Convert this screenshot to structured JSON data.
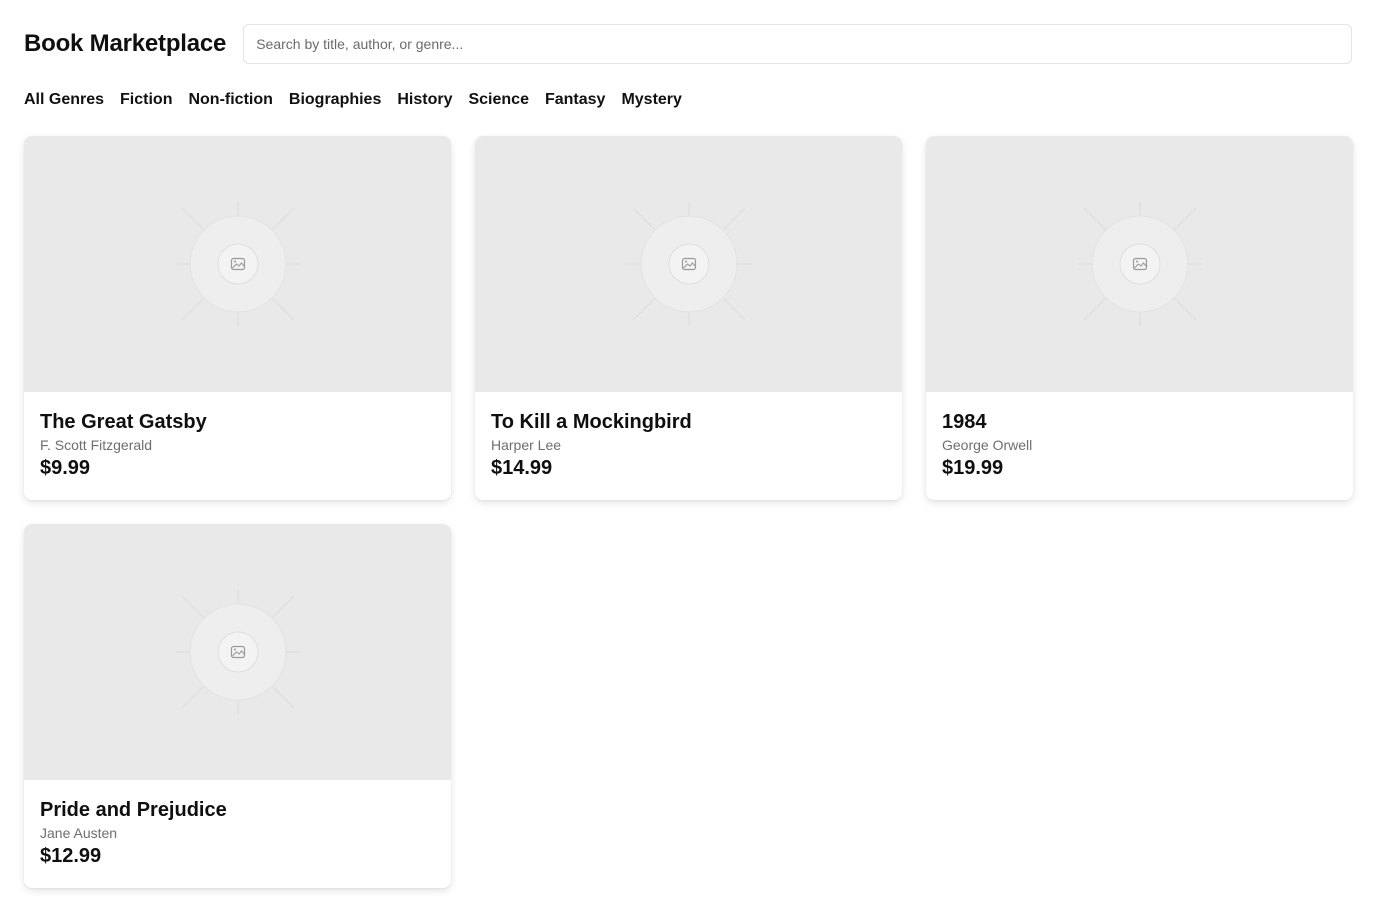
{
  "header": {
    "title": "Book Marketplace"
  },
  "search": {
    "placeholder": "Search by title, author, or genre...",
    "value": ""
  },
  "genres": [
    {
      "label": "All Genres"
    },
    {
      "label": "Fiction"
    },
    {
      "label": "Non-fiction"
    },
    {
      "label": "Biographies"
    },
    {
      "label": "History"
    },
    {
      "label": "Science"
    },
    {
      "label": "Fantasy"
    },
    {
      "label": "Mystery"
    }
  ],
  "books": [
    {
      "title": "The Great Gatsby",
      "author": "F. Scott Fitzgerald",
      "price": "$9.99",
      "cover_icon": "image-placeholder-icon"
    },
    {
      "title": "To Kill a Mockingbird",
      "author": "Harper Lee",
      "price": "$14.99",
      "cover_icon": "image-placeholder-icon"
    },
    {
      "title": "1984",
      "author": "George Orwell",
      "price": "$19.99",
      "cover_icon": "image-placeholder-icon"
    },
    {
      "title": "Pride and Prejudice",
      "author": "Jane Austen",
      "price": "$12.99",
      "cover_icon": "image-placeholder-icon"
    }
  ],
  "colors": {
    "cover_background": "#e9e9e9",
    "author_text": "#6e6e6e",
    "text": "#111111"
  }
}
